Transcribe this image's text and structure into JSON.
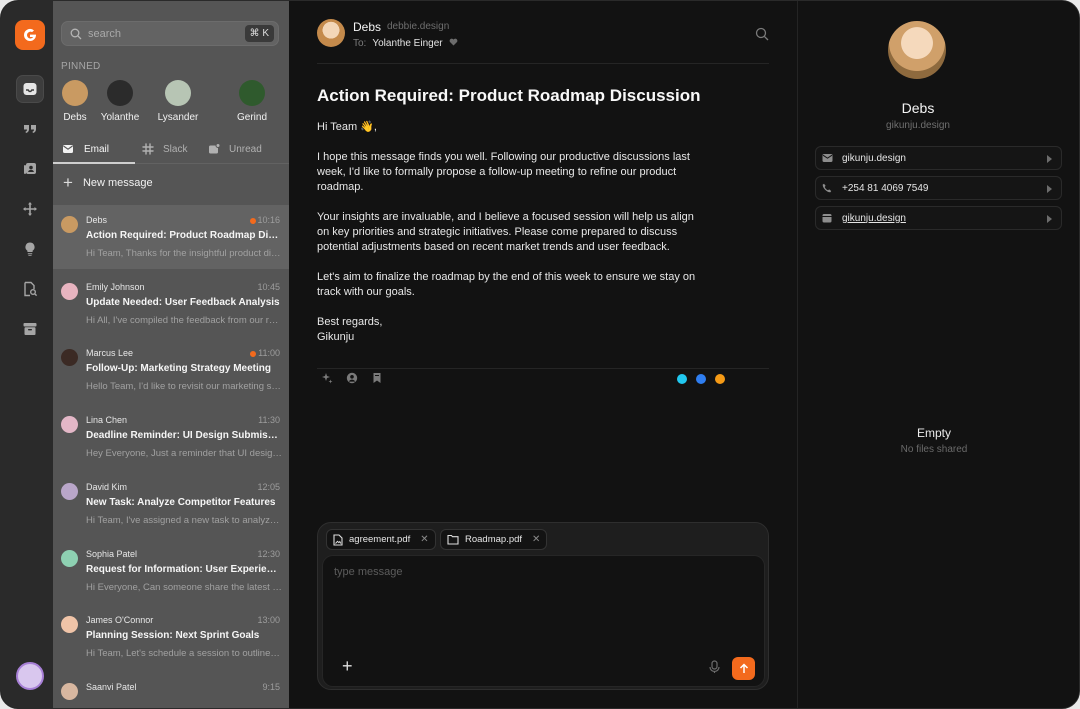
{
  "search": {
    "placeholder": "search",
    "shortcut": "⌘ K"
  },
  "pinned": {
    "label": "PINNED",
    "items": [
      {
        "name": "Debs",
        "color": "#c99a62"
      },
      {
        "name": "Yolanthe",
        "color": "#2b2b2b"
      },
      {
        "name": "Lysander",
        "color": "#b7c5b4"
      },
      {
        "name": "Gerind",
        "color": "#2f5a2d"
      }
    ]
  },
  "tabs": [
    {
      "label": "Email",
      "icon": "mail-icon"
    },
    {
      "label": "Slack",
      "icon": "slack-icon"
    },
    {
      "label": "Unread",
      "icon": "unread-icon"
    }
  ],
  "new_message_label": "New message",
  "messages": [
    {
      "from": "Debs",
      "time": "10:16",
      "unread": true,
      "subject": "Action Required: Product Roadmap Discussion",
      "preview": "Hi Team, Thanks for the insightful product discussion",
      "avatar": "#c99a62"
    },
    {
      "from": "Emily Johnson",
      "time": "10:45",
      "unread": false,
      "subject": "Update Needed: User Feedback Analysis",
      "preview": "Hi All, I've compiled the feedback from our recent",
      "avatar": "#e8b4c0"
    },
    {
      "from": "Marcus Lee",
      "time": "11:00",
      "unread": true,
      "subject": "Follow-Up: Marketing Strategy Meeting",
      "preview": "Hello Team, I'd like to revisit our marketing strategy",
      "avatar": "#3b2a24"
    },
    {
      "from": "Lina Chen",
      "time": "11:30",
      "unread": false,
      "subject": "Deadline Reminder: UI Design Submission",
      "preview": "Hey Everyone, Just a reminder that UI designs are due",
      "avatar": "#e3b7c7"
    },
    {
      "from": "David Kim",
      "time": "12:05",
      "unread": false,
      "subject": "New Task: Analyze Competitor Features",
      "preview": "Hi Team, I've assigned a new task to analyze our",
      "avatar": "#b9a6c9"
    },
    {
      "from": "Sophia Patel",
      "time": "12:30",
      "unread": false,
      "subject": "Request for Information: User Experience Survey",
      "preview": "Hi Everyone, Can someone share the latest survey",
      "avatar": "#8ed1b2"
    },
    {
      "from": "James O'Connor",
      "time": "13:00",
      "unread": false,
      "subject": "Planning Session: Next Sprint Goals",
      "preview": "Hi Team, Let's schedule a session to outline our goals",
      "avatar": "#f0c4a8"
    },
    {
      "from": "Saanvi Patel",
      "time": "9:15",
      "unread": false,
      "subject": "",
      "preview": "",
      "avatar": "#d8b7a0"
    }
  ],
  "email": {
    "sender_name": "Debs",
    "sender_handle": "debbie.design",
    "to_label": "To:",
    "to_name": "Yolanthe Einger",
    "subject": "Action Required: Product Roadmap Discussion",
    "greeting": "Hi Team 👋,",
    "paragraphs": [
      "I hope this message finds you well. Following our productive discussions last week, I'd like to formally propose a follow-up meeting to refine our product roadmap.",
      "Your insights are invaluable, and I believe a focused session will help us align on key priorities and strategic initiatives. Please come prepared to discuss potential adjustments based on recent market trends and user feedback.",
      "Let's aim to finalize the roadmap by the end of this week to ensure we stay on track with our goals."
    ],
    "signoff": "Best regards,",
    "signature": "Gikunju",
    "dot_colors": [
      "#21c8f0",
      "#2f7ef0",
      "#f59a16"
    ]
  },
  "composer": {
    "attachments": [
      "agreement.pdf",
      "Roadmap.pdf"
    ],
    "placeholder": "type message"
  },
  "contact": {
    "name": "Debs",
    "handle": "gikunju.design",
    "details": [
      {
        "icon": "mail-icon",
        "value": "gikunju.design",
        "link": false
      },
      {
        "icon": "phone-icon",
        "value": "+254 81 4069 7549",
        "link": false
      },
      {
        "icon": "calendar-icon",
        "value": "gikunju.design",
        "link": true
      }
    ],
    "empty_title": "Empty",
    "empty_subtitle": "No files shared"
  },
  "colors": {
    "accent": "#f36a1d"
  }
}
